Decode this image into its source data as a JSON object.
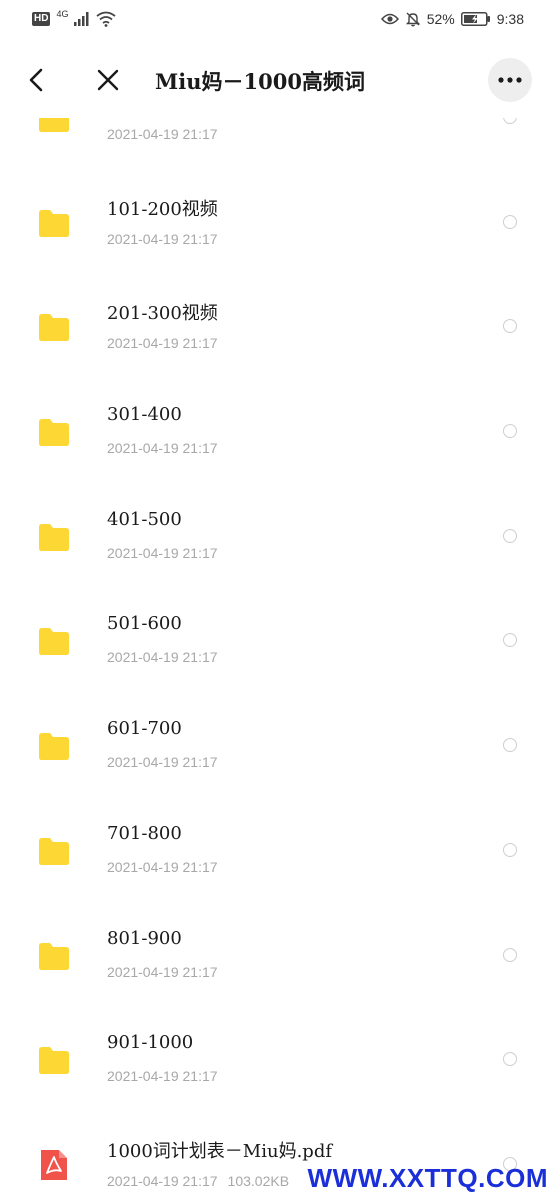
{
  "status_bar": {
    "hd": "HD",
    "network": "4G",
    "battery_percent": "52%",
    "time": "9:38"
  },
  "header": {
    "title": "Miu妈－1000高频词"
  },
  "files": [
    {
      "name": "",
      "date": "2021-04-19 21:17",
      "type": "folder",
      "size": ""
    },
    {
      "name": "101-200视频",
      "date": "2021-04-19 21:17",
      "type": "folder",
      "size": ""
    },
    {
      "name": "201-300视频",
      "date": "2021-04-19 21:17",
      "type": "folder",
      "size": ""
    },
    {
      "name": "301-400",
      "date": "2021-04-19 21:17",
      "type": "folder",
      "size": ""
    },
    {
      "name": "401-500",
      "date": "2021-04-19 21:17",
      "type": "folder",
      "size": ""
    },
    {
      "name": "501-600",
      "date": "2021-04-19 21:17",
      "type": "folder",
      "size": ""
    },
    {
      "name": "601-700",
      "date": "2021-04-19 21:17",
      "type": "folder",
      "size": ""
    },
    {
      "name": "701-800",
      "date": "2021-04-19 21:17",
      "type": "folder",
      "size": ""
    },
    {
      "name": "801-900",
      "date": "2021-04-19 21:17",
      "type": "folder",
      "size": ""
    },
    {
      "name": "901-1000",
      "date": "2021-04-19 21:17",
      "type": "folder",
      "size": ""
    },
    {
      "name": "1000词计划表－Miu妈.pdf",
      "date": "2021-04-19 21:17",
      "type": "pdf",
      "size": "103.02KB"
    }
  ],
  "icons": {
    "folder": "folder-icon",
    "pdf": "pdf-icon"
  },
  "colors": {
    "folder": "#FDD835",
    "pdf": "#F0534A",
    "meta_text": "#A8A8A8",
    "watermark": "#1A2FD8"
  },
  "watermark": "WWW.XXTTQ.COM"
}
